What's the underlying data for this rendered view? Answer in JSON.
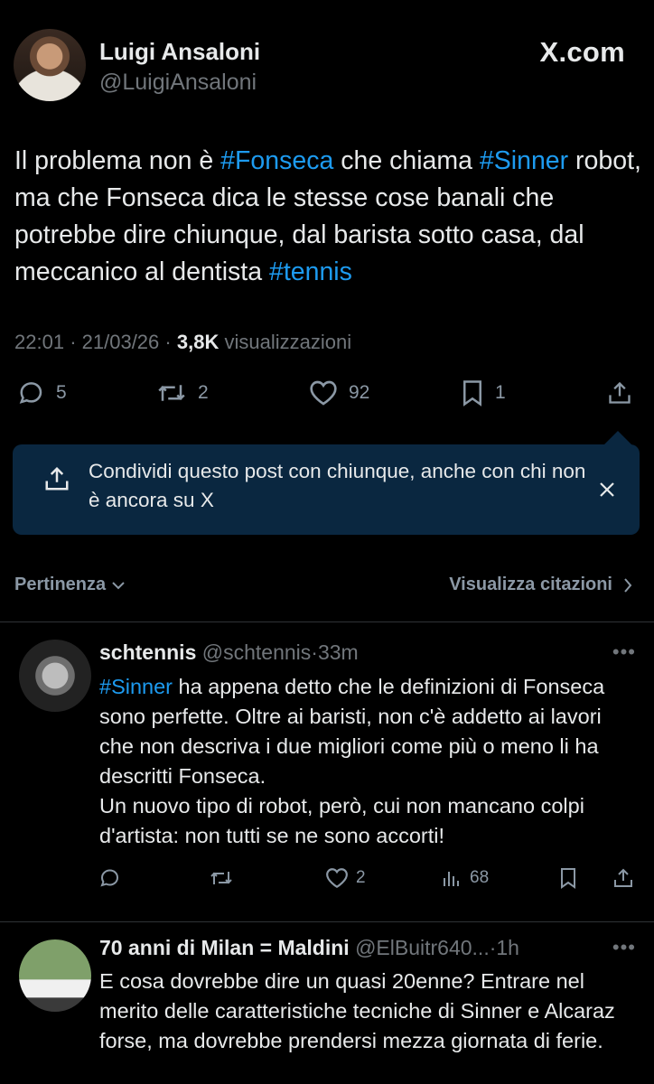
{
  "tweet": {
    "author_name": "Luigi Ansaloni",
    "author_handle": "@LuigiAnsaloni",
    "site_logo": "X.com",
    "text_parts": [
      {
        "t": "Il problema non è "
      },
      {
        "t": "#Fonseca",
        "tag": true
      },
      {
        "t": " che chiama "
      },
      {
        "t": "#Sinner",
        "tag": true
      },
      {
        "t": " robot, ma che Fonseca dica le stesse cose banali che potrebbe dire chiunque, dal barista sotto casa, dal meccanico al dentista "
      },
      {
        "t": "#tennis",
        "tag": true
      }
    ],
    "time": "22:01",
    "date": "21/03/26",
    "views_count": "3,8K",
    "views_label": "visualizzazioni",
    "sep": "·",
    "replies": "5",
    "retweets": "2",
    "likes": "92",
    "bookmarks": "1"
  },
  "share_banner": {
    "text": "Condividi questo post con chiunque, anche con chi non è ancora su X",
    "icon": "share-icon",
    "close_icon": "close-icon"
  },
  "sort": {
    "left_label": "Pertinenza",
    "right_label": "Visualizza citazioni"
  },
  "replies": [
    {
      "name": "schtennis",
      "handle": "@schtennis",
      "age": "33m",
      "text_parts": [
        {
          "t": "#Sinner",
          "tag": true
        },
        {
          "t": " ha appena detto che le definizioni di Fonseca sono perfette. Oltre ai baristi, non c'è addetto ai lavori che non descriva i due migliori come più o meno li ha descritti Fonseca.\nUn nuovo tipo di robot, però, cui non mancano colpi d'artista: non tutti se ne sono accorti!"
        }
      ],
      "likes": "2",
      "views": "68"
    },
    {
      "name": "70 anni di Milan = Maldini",
      "handle": "@ElBuitr640...",
      "age": "1h",
      "text_parts": [
        {
          "t": "E cosa dovrebbe dire un quasi 20enne? Entrare nel merito delle caratteristiche tecniche di Sinner e Alcaraz forse, ma dovrebbe prendersi mezza giornata di ferie."
        }
      ]
    }
  ],
  "colors": {
    "background": "#000000",
    "text": "#e7e9ea",
    "secondary": "#71767b",
    "accent": "#1d9bf0",
    "banner": "#0a2740"
  }
}
